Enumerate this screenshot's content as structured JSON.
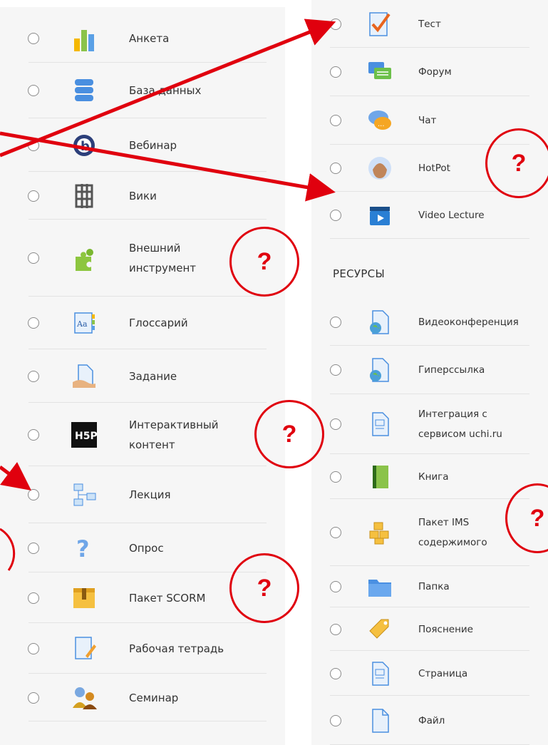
{
  "left_items": [
    {
      "label": "Анкета",
      "icon": "survey-bars-icon"
    },
    {
      "label": "База данных",
      "icon": "database-icon"
    },
    {
      "label": "Вебинар",
      "icon": "webinar-icon"
    },
    {
      "label": "Вики",
      "icon": "wiki-icon"
    },
    {
      "label": "Внешний",
      "label2": "инструмент",
      "icon": "external-tool-puzzle-icon"
    },
    {
      "label": "Глоссарий",
      "icon": "glossary-icon"
    },
    {
      "label": "Задание",
      "icon": "assignment-icon"
    },
    {
      "label": "Интерактивный",
      "label2": "контент",
      "icon": "h5p-icon"
    },
    {
      "label": "Лекция",
      "icon": "lesson-icon"
    },
    {
      "label": "Опрос",
      "icon": "question-icon"
    },
    {
      "label": "Пакет SCORM",
      "icon": "scorm-package-icon"
    },
    {
      "label": "Рабочая тетрадь",
      "icon": "workbook-icon"
    },
    {
      "label": "Семинар",
      "icon": "workshop-icon"
    }
  ],
  "right_items": [
    {
      "label": "Тест",
      "icon": "quiz-check-icon"
    },
    {
      "label": "Форум",
      "icon": "forum-icon"
    },
    {
      "label": "Чат",
      "icon": "chat-icon"
    },
    {
      "label": "HotPot",
      "icon": "hotpot-icon"
    },
    {
      "label": "Video Lecture",
      "icon": "video-clapper-icon"
    }
  ],
  "resources_title": "РЕСУРСЫ",
  "resource_items": [
    {
      "label": "Видеоконференция",
      "icon": "globe-page-icon"
    },
    {
      "label": "Гиперссылка",
      "icon": "url-globe-icon"
    },
    {
      "label": "Интеграция с",
      "label2": "сервисом uchi.ru",
      "icon": "integration-page-icon"
    },
    {
      "label": "Книга",
      "icon": "book-icon"
    },
    {
      "label": "Пакет IMS",
      "label2": "содержимого",
      "icon": "ims-package-icon"
    },
    {
      "label": "Папка",
      "icon": "folder-icon"
    },
    {
      "label": "Пояснение",
      "icon": "label-tag-icon"
    },
    {
      "label": "Страница",
      "icon": "page-icon"
    },
    {
      "label": "Файл",
      "icon": "file-icon"
    }
  ],
  "question_marks": [
    "?",
    "?",
    "?",
    "?",
    "?",
    "?"
  ],
  "colors": {
    "annotation": "#e0000e",
    "panel": "#f6f6f6",
    "text": "#333333"
  }
}
